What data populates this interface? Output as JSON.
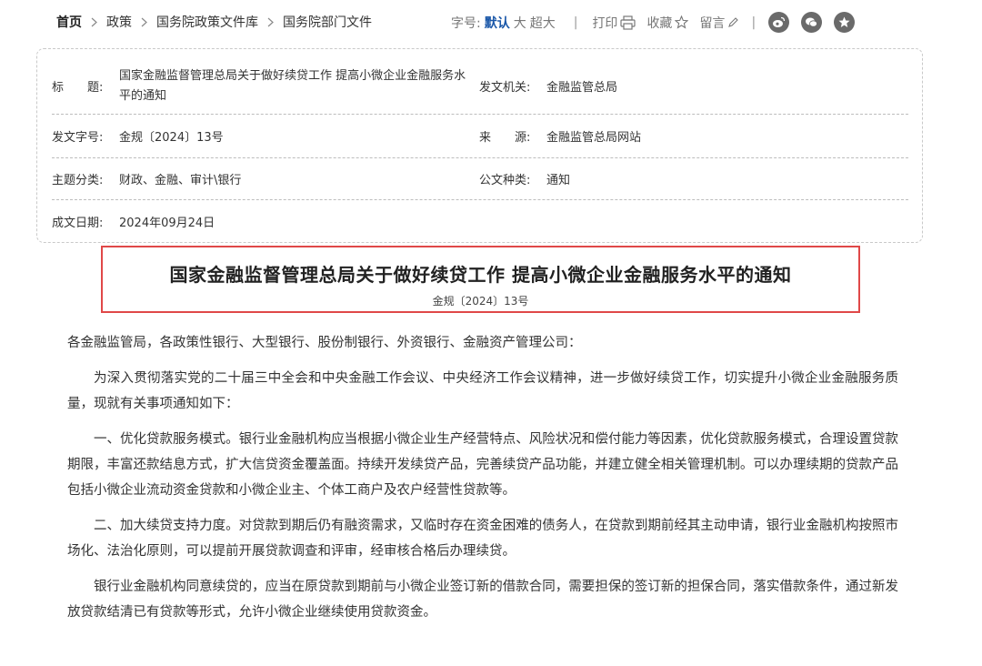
{
  "breadcrumb": {
    "items": [
      "首页",
      "政策",
      "国务院政策文件库",
      "国务院部门文件"
    ]
  },
  "toolbar": {
    "font_size_label": "字号:",
    "font_sizes": [
      "默认",
      "大",
      "超大"
    ],
    "divider": "|",
    "print_label": "打印",
    "favorite_label": "收藏",
    "comment_label": "留言",
    "share_icons": [
      "weibo-icon",
      "wechat-icon",
      "qzone-icon"
    ]
  },
  "meta": {
    "title_label": "标　　题:",
    "title_value": "国家金融监督管理总局关于做好续贷工作 提高小微企业金融服务水平的通知",
    "issuer_label": "发文机关:",
    "issuer_value": "金融监管总局",
    "doc_no_label": "发文字号:",
    "doc_no_value": "金规〔2024〕13号",
    "source_label": "来　　源:",
    "source_value": "金融监管总局网站",
    "category_label": "主题分类:",
    "category_value": "财政、金融、审计\\银行",
    "doc_type_label": "公文种类:",
    "doc_type_value": "通知",
    "date_label": "成文日期:",
    "date_value": "2024年09月24日"
  },
  "document": {
    "title": "国家金融监督管理总局关于做好续贷工作 提高小微企业金融服务水平的通知",
    "number": "金规〔2024〕13号",
    "paragraphs": [
      "各金融监管局，各政策性银行、大型银行、股份制银行、外资银行、金融资产管理公司：",
      "为深入贯彻落实党的二十届三中全会和中央金融工作会议、中央经济工作会议精神，进一步做好续贷工作，切实提升小微企业金融服务质量，现就有关事项通知如下：",
      "一、优化贷款服务模式。银行业金融机构应当根据小微企业生产经营特点、风险状况和偿付能力等因素，优化贷款服务模式，合理设置贷款期限，丰富还款结息方式，扩大信贷资金覆盖面。持续开发续贷产品，完善续贷产品功能，并建立健全相关管理机制。可以办理续期的贷款产品包括小微企业流动资金贷款和小微企业主、个体工商户及农户经营性贷款等。",
      "二、加大续贷支持力度。对贷款到期后仍有融资需求，又临时存在资金困难的债务人，在贷款到期前经其主动申请，银行业金融机构按照市场化、法治化原则，可以提前开展贷款调查和评审，经审核合格后办理续贷。",
      "银行业金融机构同意续贷的，应当在原贷款到期前与小微企业签订新的借款合同，需要担保的签订新的担保合同，落实借款条件，通过新发放贷款结清已有贷款等形式，允许小微企业继续使用贷款资金。"
    ]
  },
  "colors": {
    "highlight_border": "#e04848",
    "active_font_size": "#1a57a8"
  }
}
